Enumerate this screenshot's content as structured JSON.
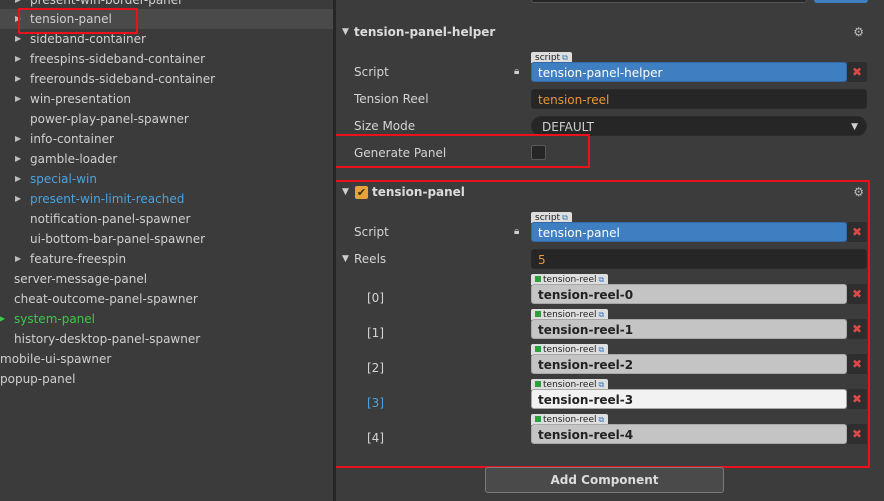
{
  "hierarchy": {
    "items": [
      {
        "label": "present-win-border-panel",
        "has_children": true,
        "color": "normal",
        "selected": false
      },
      {
        "label": "tension-panel",
        "has_children": true,
        "color": "normal",
        "selected": true
      },
      {
        "label": "sideband-container",
        "has_children": true,
        "color": "normal",
        "selected": false
      },
      {
        "label": "freespins-sideband-container",
        "has_children": true,
        "color": "normal",
        "selected": false
      },
      {
        "label": "freerounds-sideband-container",
        "has_children": true,
        "color": "normal",
        "selected": false
      },
      {
        "label": "win-presentation",
        "has_children": true,
        "color": "normal",
        "selected": false
      },
      {
        "label": "power-play-panel-spawner",
        "has_children": false,
        "color": "normal",
        "selected": false
      },
      {
        "label": "info-container",
        "has_children": true,
        "color": "normal",
        "selected": false
      },
      {
        "label": "gamble-loader",
        "has_children": true,
        "color": "normal",
        "selected": false
      },
      {
        "label": "special-win",
        "has_children": true,
        "color": "blue",
        "selected": false
      },
      {
        "label": "present-win-limit-reached",
        "has_children": true,
        "color": "blue",
        "selected": false
      },
      {
        "label": "notification-panel-spawner",
        "has_children": false,
        "color": "normal",
        "selected": false
      },
      {
        "label": "ui-bottom-bar-panel-spawner",
        "has_children": false,
        "color": "normal",
        "selected": false
      },
      {
        "label": "feature-freespin",
        "has_children": true,
        "color": "normal",
        "selected": false
      },
      {
        "label": "server-message-panel",
        "has_children": false,
        "color": "normal",
        "selected": false
      },
      {
        "label": "cheat-outcome-panel-spawner",
        "has_children": false,
        "color": "normal",
        "selected": false
      },
      {
        "label": "system-panel",
        "has_children": true,
        "color": "green",
        "selected": false
      },
      {
        "label": "history-desktop-panel-spawner",
        "has_children": false,
        "color": "normal",
        "selected": false
      },
      {
        "label": "mobile-ui-spawner",
        "has_children": false,
        "color": "normal",
        "selected": false
      },
      {
        "label": "popup-panel",
        "has_children": false,
        "color": "normal",
        "selected": false
      }
    ]
  },
  "inspector": {
    "helper": {
      "title": "tension-panel-helper",
      "script_tag": "script",
      "script_label": "Script",
      "script_value": "tension-panel-helper",
      "tension_reel_label": "Tension Reel",
      "tension_reel_value": "tension-reel",
      "size_mode_label": "Size Mode",
      "size_mode_value": "DEFAULT",
      "generate_panel_label": "Generate Panel",
      "generate_panel_checked": false
    },
    "panel": {
      "title": "tension-panel",
      "enabled": true,
      "script_tag": "script",
      "script_label": "Script",
      "script_value": "tension-panel",
      "reels_label": "Reels",
      "reels_count": "5",
      "reel_tag": "tension-reel",
      "reels": [
        {
          "index": "[0]",
          "value": "tension-reel-0",
          "active": false
        },
        {
          "index": "[1]",
          "value": "tension-reel-1",
          "active": false
        },
        {
          "index": "[2]",
          "value": "tension-reel-2",
          "active": false
        },
        {
          "index": "[3]",
          "value": "tension-reel-3",
          "active": true
        },
        {
          "index": "[4]",
          "value": "tension-reel-4",
          "active": false
        }
      ]
    },
    "add_component_label": "Add Component",
    "colors": {
      "script_field": "#3f7fc1",
      "reel_value": "#e8943a",
      "highlight": "#e8121e",
      "blue_text": "#4aa3df",
      "green_text": "#3cc84a",
      "checkbox_on": "#e8a23a"
    }
  }
}
